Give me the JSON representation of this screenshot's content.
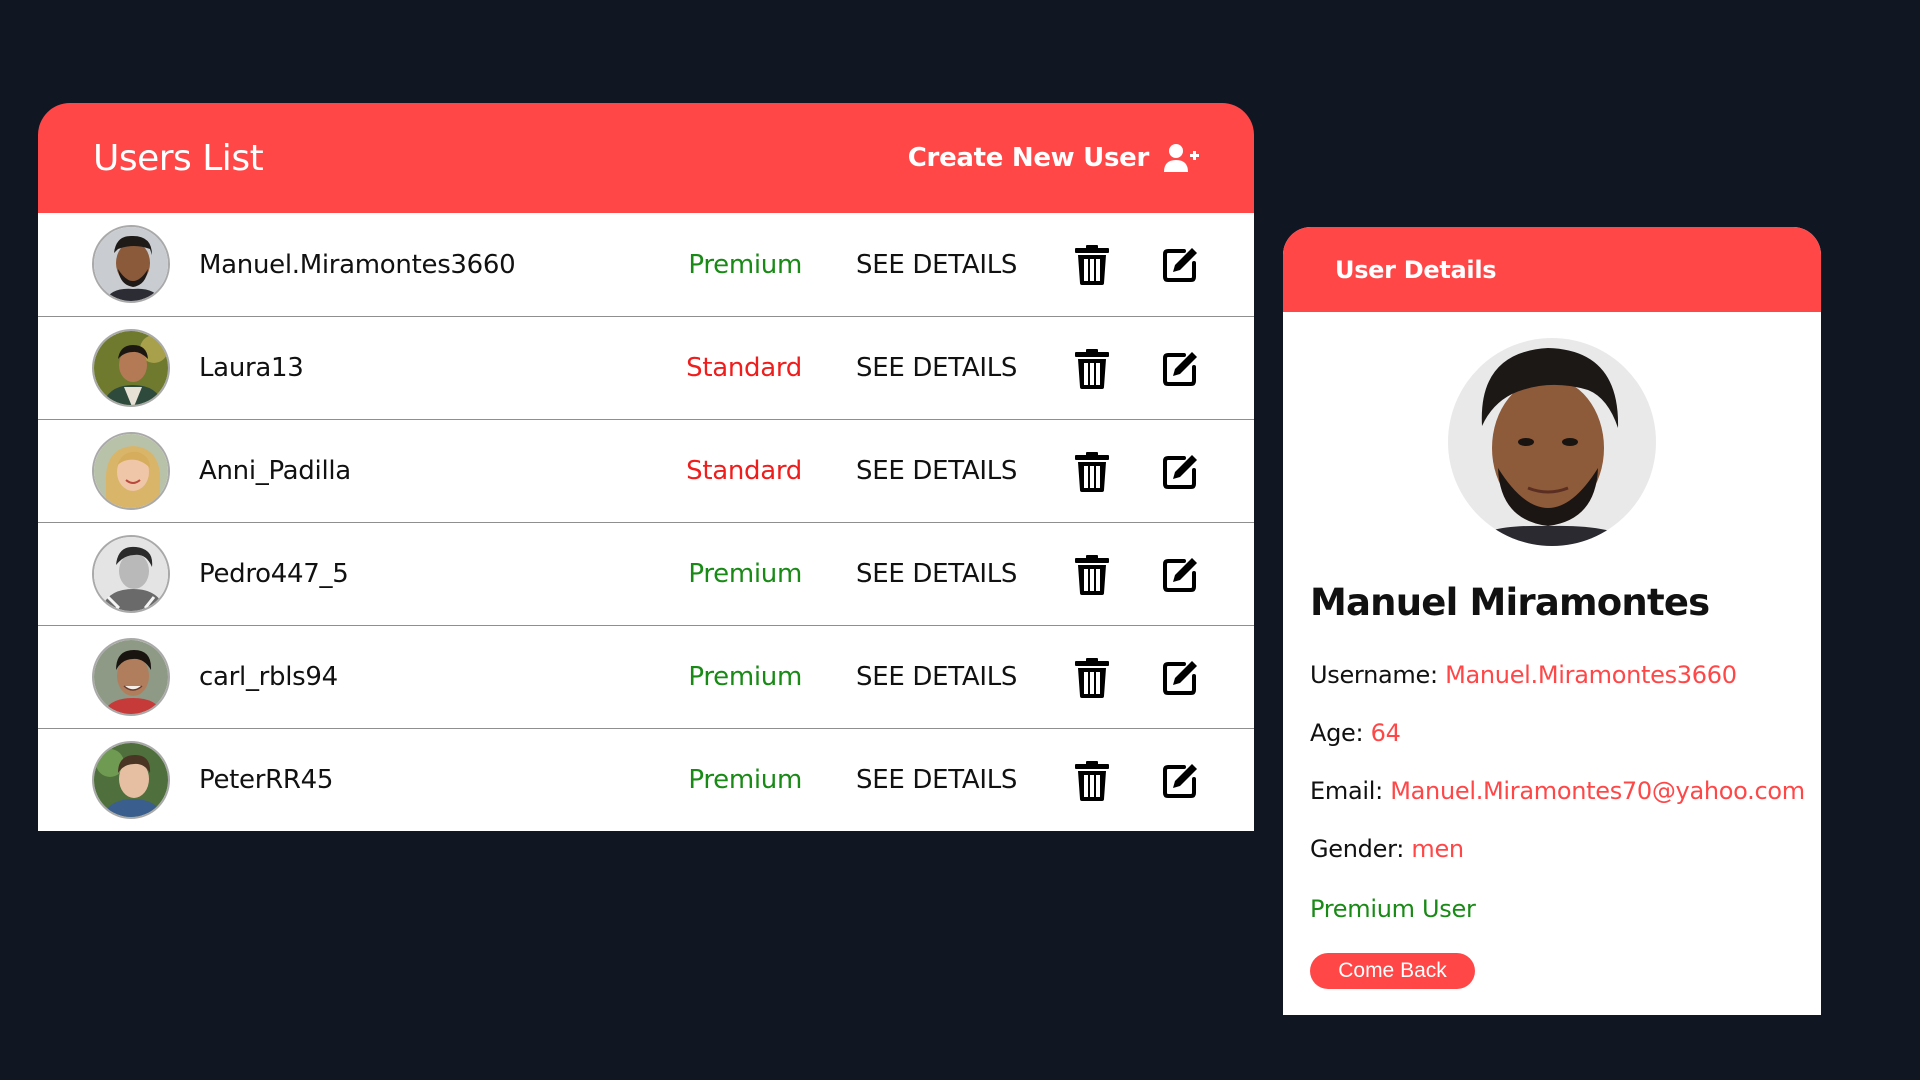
{
  "colors": {
    "background": "#111722",
    "accent": "#ff4748",
    "premium": "#1a8a17",
    "standard": "#f01d1d"
  },
  "users_list": {
    "title": "Users List",
    "create_user_label": "Create New User",
    "create_user_icon": "user-plus-icon",
    "see_details_label": "SEE DETAILS",
    "delete_icon": "trash-icon",
    "edit_icon": "edit-icon",
    "rows": [
      {
        "username": "Manuel.Miramontes3660",
        "plan": "Premium"
      },
      {
        "username": "Laura13",
        "plan": "Standard"
      },
      {
        "username": "Anni_Padilla",
        "plan": "Standard"
      },
      {
        "username": "Pedro447_5",
        "plan": "Premium"
      },
      {
        "username": "carl_rbls94",
        "plan": "Premium"
      },
      {
        "username": "PeterRR45",
        "plan": "Premium"
      }
    ]
  },
  "user_details": {
    "header": "User Details",
    "name": "Manuel Miramontes",
    "username_label": "Username:",
    "username": "Manuel.Miramontes3660",
    "age_label": "Age:",
    "age": "64",
    "email_label": "Email:",
    "email": "Manuel.Miramontes70@yahoo.com",
    "gender_label": "Gender:",
    "gender": "men",
    "status": "Premium User",
    "back_button": "Come Back"
  }
}
